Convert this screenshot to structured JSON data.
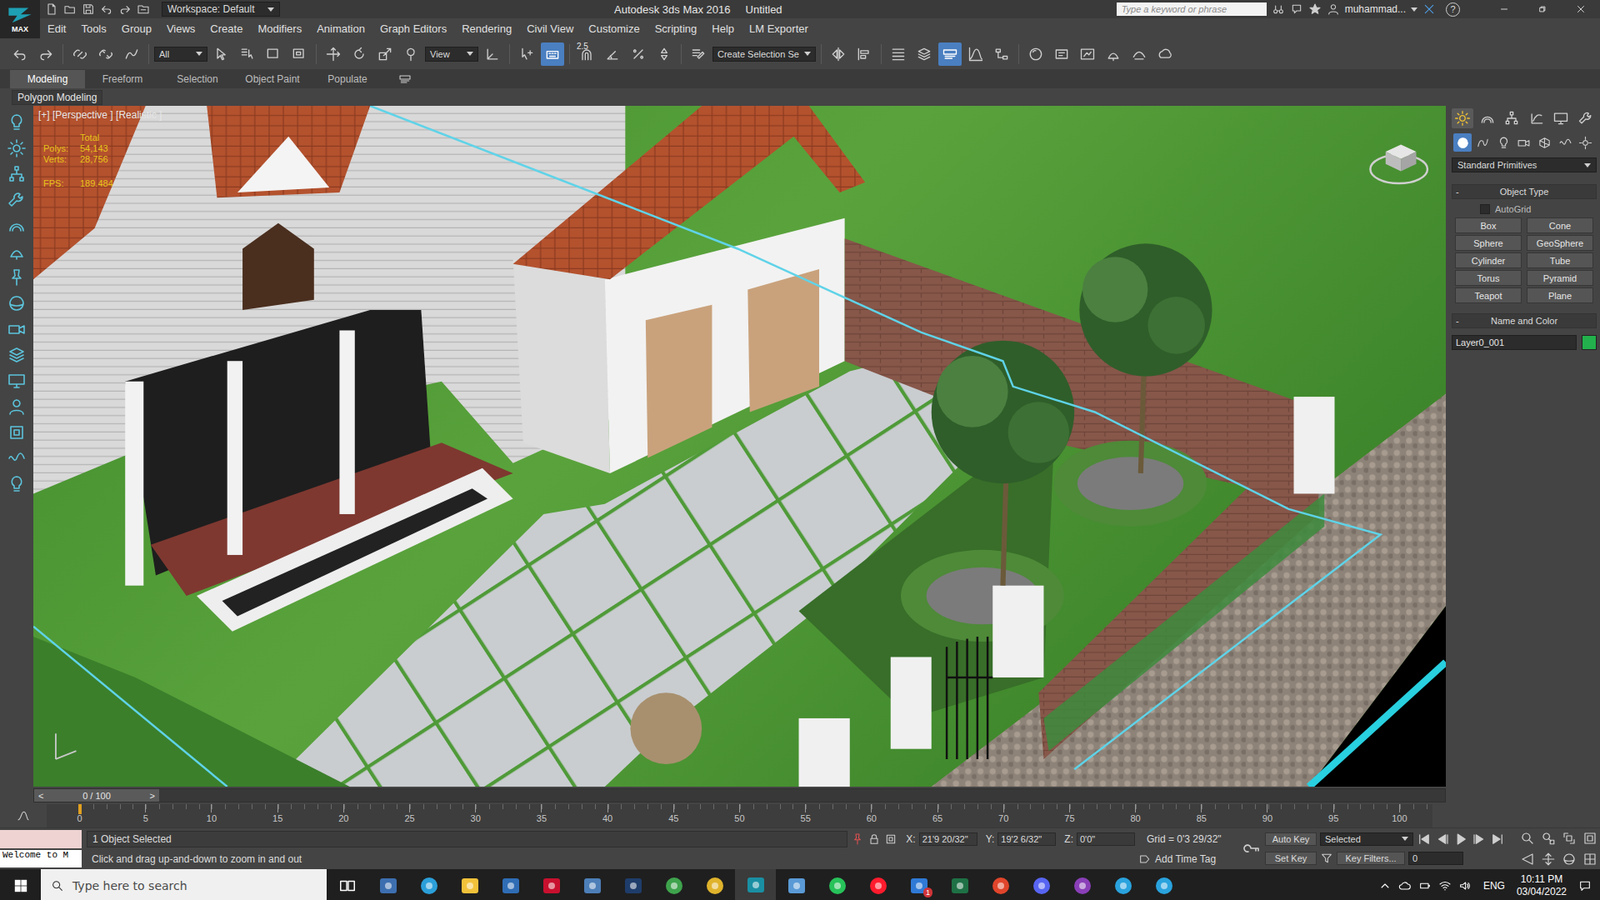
{
  "window": {
    "logo": "MAX",
    "title": "Autodesk 3ds Max 2016",
    "document": "Untitled",
    "workspace": "Workspace: Default",
    "search_placeholder": "Type a keyword or phrase",
    "user": "muhammad...",
    "help": "?"
  },
  "menu": [
    "Edit",
    "Tools",
    "Group",
    "Views",
    "Create",
    "Modifiers",
    "Animation",
    "Graph Editors",
    "Rendering",
    "Civil View",
    "Customize",
    "Scripting",
    "Help",
    "LM Exporter"
  ],
  "toolbar": [
    {
      "kind": "undo",
      "active": false
    },
    {
      "kind": "redo",
      "active": false
    },
    {
      "kind": "sep"
    },
    {
      "kind": "link",
      "active": false
    },
    {
      "kind": "unlink",
      "active": false
    },
    {
      "kind": "bind",
      "active": false
    },
    {
      "kind": "sep"
    },
    {
      "kind": "dropdown",
      "label": "All"
    },
    {
      "kind": "select",
      "active": false
    },
    {
      "kind": "selname",
      "active": false
    },
    {
      "kind": "rect",
      "active": false
    },
    {
      "kind": "window",
      "active": false
    },
    {
      "kind": "sep"
    },
    {
      "kind": "move",
      "active": false
    },
    {
      "kind": "rotate",
      "active": false
    },
    {
      "kind": "scale",
      "active": false
    },
    {
      "kind": "place",
      "active": false
    },
    {
      "kind": "dropdown",
      "label": "View"
    },
    {
      "kind": "pivot",
      "active": false
    },
    {
      "kind": "sep"
    },
    {
      "kind": "manip",
      "active": false
    },
    {
      "kind": "keyshort",
      "active": true
    },
    {
      "kind": "sep"
    },
    {
      "kind": "snap",
      "label": "2.5",
      "active": false
    },
    {
      "kind": "anglesnap",
      "active": false
    },
    {
      "kind": "pctsnap",
      "active": false
    },
    {
      "kind": "spinsnap",
      "active": false
    },
    {
      "kind": "sep"
    },
    {
      "kind": "editsel",
      "active": false
    },
    {
      "kind": "dropdown",
      "label": "Create Selection Se"
    },
    {
      "kind": "sep"
    },
    {
      "kind": "mirror",
      "active": false
    },
    {
      "kind": "align",
      "active": false
    },
    {
      "kind": "sep"
    },
    {
      "kind": "explorer",
      "active": false
    },
    {
      "kind": "layer",
      "active": false
    },
    {
      "kind": "ribbon",
      "active": true
    },
    {
      "kind": "curve",
      "active": false
    },
    {
      "kind": "schematic",
      "active": false
    },
    {
      "kind": "sep"
    },
    {
      "kind": "material",
      "active": false
    },
    {
      "kind": "rendersetup",
      "active": false
    },
    {
      "kind": "frame",
      "active": false
    },
    {
      "kind": "render",
      "active": false
    },
    {
      "kind": "render2",
      "active": false
    },
    {
      "kind": "a360",
      "active": false
    }
  ],
  "ribbon": {
    "tabs": [
      {
        "label": "Modeling",
        "selected": true
      },
      {
        "label": "Freeform",
        "selected": false
      },
      {
        "label": "Selection",
        "selected": false
      },
      {
        "label": "Object Paint",
        "selected": false
      },
      {
        "label": "Populate",
        "selected": false
      }
    ],
    "panel": "Polygon Modeling"
  },
  "viewport": {
    "label": "[+] [Perspective ] [Realistic ]",
    "stats_title": "Total",
    "stats": [
      {
        "label": "Polys:",
        "value": "54,143"
      },
      {
        "label": "Verts:",
        "value": "28,756"
      }
    ],
    "fps": {
      "label": "FPS:",
      "value": "189.484"
    }
  },
  "command_panel": {
    "tabs": [
      {
        "kind": "create",
        "selected": true
      },
      {
        "kind": "modify",
        "selected": false
      },
      {
        "kind": "hierarchy",
        "selected": false
      },
      {
        "kind": "motion",
        "selected": false
      },
      {
        "kind": "display",
        "selected": false
      },
      {
        "kind": "utilities",
        "selected": false
      }
    ],
    "categories": [
      {
        "kind": "geometry",
        "selected": true
      },
      {
        "kind": "shapes",
        "selected": false
      },
      {
        "kind": "lights",
        "selected": false
      },
      {
        "kind": "cameras",
        "selected": false
      },
      {
        "kind": "helpers",
        "selected": false
      },
      {
        "kind": "spacewarps",
        "selected": false
      },
      {
        "kind": "systems",
        "selected": false
      }
    ],
    "dropdown": "Standard Primitives",
    "object_type": {
      "toggle": "-",
      "title": "Object Type",
      "autogrid": {
        "label": "AutoGrid",
        "checked": false
      },
      "buttons": [
        "Box",
        "Cone",
        "Sphere",
        "GeoSphere",
        "Cylinder",
        "Tube",
        "Torus",
        "Pyramid",
        "Teapot",
        "Plane"
      ]
    },
    "name_color": {
      "toggle": "-",
      "title": "Name and Color",
      "name": "Layer0_001",
      "color": "#22b14c"
    }
  },
  "timeline": {
    "prev": "<",
    "position": "0 / 100",
    "next": ">",
    "level": 0,
    "ticks": [
      "0",
      "5",
      "10",
      "15",
      "20",
      "25",
      "30",
      "35",
      "40",
      "45",
      "50",
      "55",
      "60",
      "65",
      "70",
      "75",
      "80",
      "85",
      "90",
      "95",
      "100"
    ]
  },
  "status": {
    "listener": "Welcome to M",
    "selection": "1 Object Selected",
    "prompt": "Click and drag up-and-down to zoom in and out",
    "coords": [
      {
        "label": "X:",
        "value": "21'9 20/32\""
      },
      {
        "label": "Y:",
        "value": "19'2 6/32\""
      },
      {
        "label": "Z:",
        "value": "0'0\""
      }
    ],
    "grid": "Grid = 0'3 29/32\"",
    "time_tag": "Add Time Tag",
    "auto_key": {
      "label": "Auto Key",
      "on": false
    },
    "key_mode": "Selected",
    "set_key": "Set Key",
    "key_filters": "Key Filters...",
    "frame": "0"
  },
  "taskbar": {
    "search": "Type here to search",
    "apps": [
      {
        "kind": "taskview",
        "color": "#ffffff",
        "active": false
      },
      {
        "kind": "calc",
        "color": "#3d6fb0",
        "active": false
      },
      {
        "kind": "edge",
        "color": "#2b9fd9",
        "active": false
      },
      {
        "kind": "folder",
        "color": "#f2c23a",
        "active": false
      },
      {
        "kind": "sketch",
        "color": "#2f6db5",
        "active": false
      },
      {
        "kind": "pdf",
        "color": "#c8102e",
        "active": false
      },
      {
        "kind": "tile",
        "color": "#4d7fb8",
        "active": false
      },
      {
        "kind": "ps",
        "color": "#1f3d6b",
        "active": false
      },
      {
        "kind": "chrome",
        "color": "#3fa34d",
        "active": false
      },
      {
        "kind": "chrome",
        "color": "#e0b32c",
        "active": false
      },
      {
        "kind": "max",
        "color": "#1a8fa3",
        "active": true
      },
      {
        "kind": "doc",
        "color": "#5a9ad6",
        "active": false
      },
      {
        "kind": "whatsapp",
        "color": "#27c25a",
        "active": false
      },
      {
        "kind": "opera",
        "color": "#ff1b2d",
        "active": false
      },
      {
        "kind": "todo",
        "color": "#2f7ad6",
        "active": false,
        "badge": "1"
      },
      {
        "kind": "excel",
        "color": "#1e7145",
        "active": false
      },
      {
        "kind": "g",
        "color": "#e0452b",
        "active": false
      },
      {
        "kind": "discord",
        "color": "#5865f2",
        "active": false
      },
      {
        "kind": "podcast",
        "color": "#8a3fb8",
        "active": false
      },
      {
        "kind": "telegram",
        "color": "#2aa3de",
        "active": false
      },
      {
        "kind": "telegram",
        "color": "#2aa3de",
        "active": false
      }
    ],
    "language": "ENG",
    "time": "10:11 PM",
    "date": "03/04/2022"
  }
}
